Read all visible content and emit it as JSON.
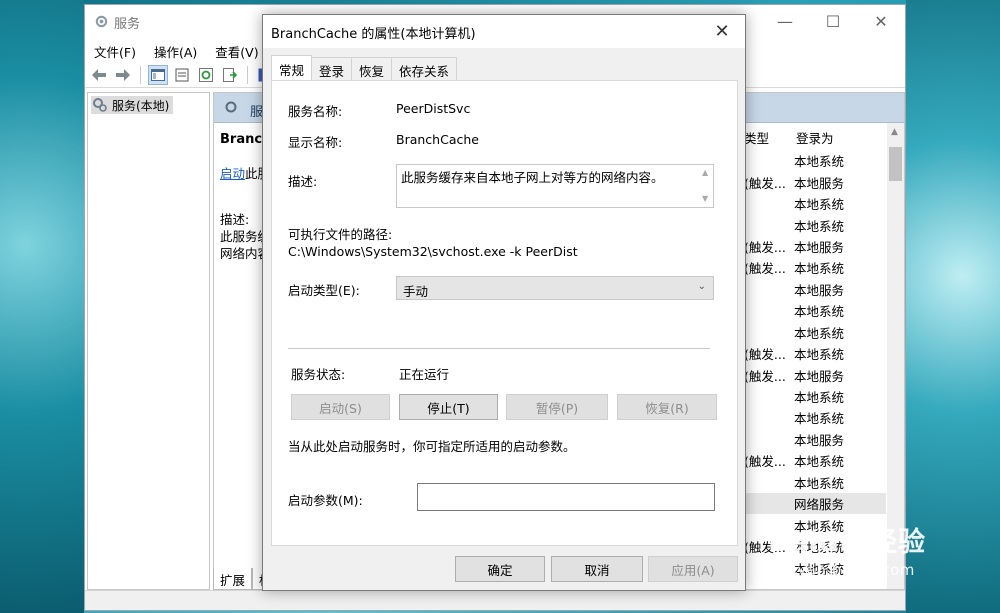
{
  "main_window": {
    "title": "服务",
    "controls": {
      "minimize": "—",
      "maximize": "☐",
      "close": "✕"
    },
    "menu": [
      "文件(F)",
      "操作(A)",
      "查看(V)"
    ],
    "tree": {
      "item": "服务(本地)"
    },
    "right_pane": {
      "header": "服务",
      "selected_name": "Branch",
      "start_link": "启动",
      "start_suffix": "此服",
      "desc_label": "描述:",
      "desc_line1": "此服务缓",
      "desc_line2": "网络内容"
    },
    "columns": {
      "type": "类型",
      "logon": "登录为"
    },
    "rows": [
      {
        "type": "",
        "logon": "本地系统"
      },
      {
        "type": "(触发...",
        "logon": "本地服务"
      },
      {
        "type": "",
        "logon": "本地系统"
      },
      {
        "type": "",
        "logon": "本地系统"
      },
      {
        "type": "(触发...",
        "logon": "本地服务"
      },
      {
        "type": "(触发...",
        "logon": "本地系统"
      },
      {
        "type": "",
        "logon": "本地服务"
      },
      {
        "type": "",
        "logon": "本地系统"
      },
      {
        "type": "",
        "logon": "本地系统"
      },
      {
        "type": "(触发...",
        "logon": "本地系统"
      },
      {
        "type": "(触发...",
        "logon": "本地服务"
      },
      {
        "type": "",
        "logon": "本地系统"
      },
      {
        "type": "",
        "logon": "本地系统"
      },
      {
        "type": "",
        "logon": "本地服务"
      },
      {
        "type": "(触发...",
        "logon": "本地系统"
      },
      {
        "type": "",
        "logon": "本地系统"
      },
      {
        "type": "",
        "logon": "网络服务"
      },
      {
        "type": "",
        "logon": "本地系统"
      },
      {
        "type": "(触发...",
        "logon": "本地系统"
      },
      {
        "type": "",
        "logon": "本地系统"
      }
    ],
    "selected_row_index": 16,
    "bottom_tabs": [
      "扩展",
      "标"
    ]
  },
  "dialog": {
    "title": "BranchCache 的属性(本地计算机)",
    "close": "✕",
    "tabs": [
      "常规",
      "登录",
      "恢复",
      "依存关系"
    ],
    "active_tab": 0,
    "service_name_label": "服务名称:",
    "service_name": "PeerDistSvc",
    "display_name_label": "显示名称:",
    "display_name": "BranchCache",
    "description_label": "描述:",
    "description": "此服务缓存来自本地子网上对等方的网络内容。",
    "path_label": "可执行文件的路径:",
    "path": "C:\\Windows\\System32\\svchost.exe -k PeerDist",
    "startup_type_label": "启动类型(E):",
    "startup_type": "手动",
    "status_label": "服务状态:",
    "status": "正在运行",
    "buttons": {
      "start": "启动(S)",
      "stop": "停止(T)",
      "pause": "暂停(P)",
      "resume": "恢复(R)"
    },
    "hint": "当从此处启动服务时，你可指定所适用的启动参数。",
    "params_label": "启动参数(M):",
    "params_value": "",
    "footer": {
      "ok": "确定",
      "cancel": "取消",
      "apply": "应用(A)"
    }
  },
  "watermark": {
    "main": "Baidu 经验",
    "sub": "jingyan.baidu.com"
  }
}
